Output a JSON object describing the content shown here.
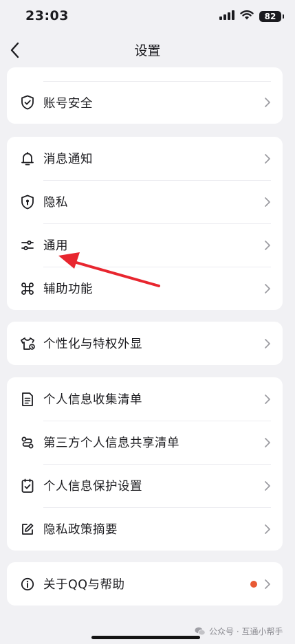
{
  "status_bar": {
    "time": "23:03",
    "battery": "82"
  },
  "nav": {
    "title": "设置"
  },
  "groups": {
    "account": {
      "security": "账号安全"
    },
    "general": {
      "notifications": "消息通知",
      "privacy": "隐私",
      "general": "通用",
      "accessibility": "辅助功能"
    },
    "personalization": {
      "label": "个性化与特权外显"
    },
    "privacy_info": {
      "collection_list": "个人信息收集清单",
      "third_party_list": "第三方个人信息共享清单",
      "protection_settings": "个人信息保护设置",
      "policy_summary": "隐私政策摘要"
    },
    "about": {
      "label": "关于QQ与帮助",
      "badge_color": "#e85a34"
    }
  },
  "annotation": {
    "color": "#e8262f"
  },
  "watermark": {
    "text": "公众号 · 互通小帮手"
  }
}
